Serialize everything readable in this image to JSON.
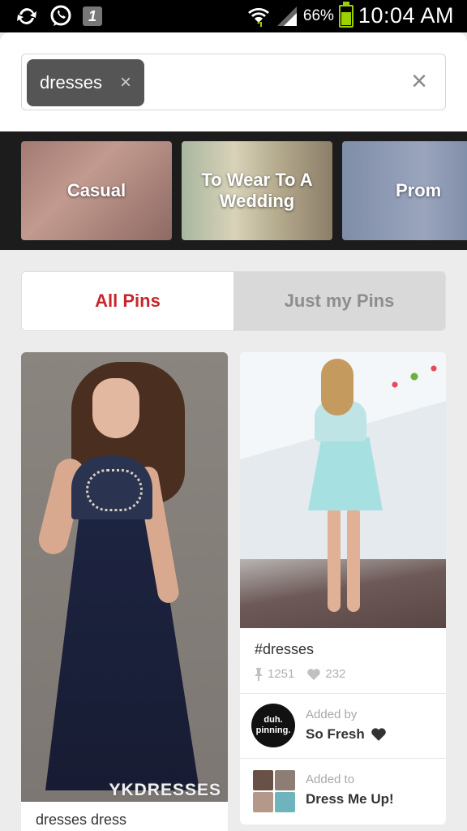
{
  "status_bar": {
    "battery_percent": "66%",
    "battery_level": 0.66,
    "time": "10:04 AM",
    "icons": [
      "sync-icon",
      "whatsapp-icon",
      "notification-1-icon",
      "wifi-icon",
      "signal-icon",
      "battery-icon"
    ],
    "notif_number": "1"
  },
  "search": {
    "chip_label": "dresses",
    "chip_remove": "×",
    "clear_label": "×"
  },
  "categories": [
    {
      "label": "Casual"
    },
    {
      "label": "To Wear To A Wedding"
    },
    {
      "label": "Prom"
    }
  ],
  "filter": {
    "all_label": "All Pins",
    "mine_label": "Just my Pins",
    "active": "All Pins",
    "active_color": "#c8262d"
  },
  "pins": [
    {
      "watermark": "YKDRESSES",
      "caption": "dresses dress"
    },
    {
      "title": "#dresses",
      "repins": "1251",
      "likes": "232",
      "added_by_label": "Added by",
      "added_by": "So Fresh",
      "added_by_avatar": "duh. pinning.",
      "added_to_label": "Added to",
      "added_to": "Dress Me Up!"
    }
  ]
}
